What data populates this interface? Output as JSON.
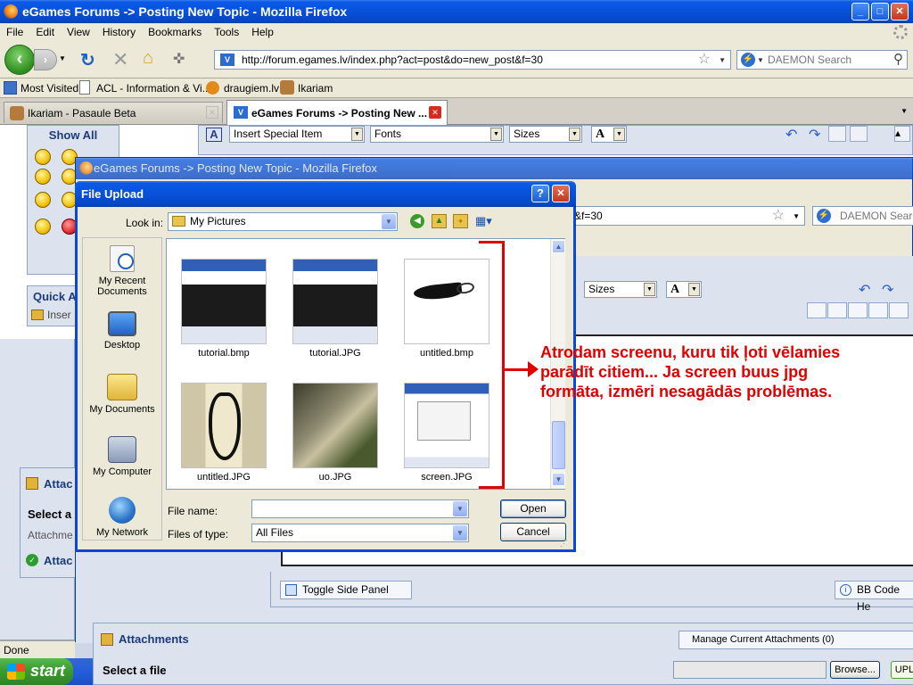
{
  "window": {
    "title": "eGames Forums -> Posting New Topic - Mozilla Firefox",
    "controls": {
      "min": "_",
      "max": "□",
      "close": "✕"
    }
  },
  "menu": [
    "File",
    "Edit",
    "View",
    "History",
    "Bookmarks",
    "Tools",
    "Help"
  ],
  "nav": {
    "url": "http://forum.egames.lv/index.php?act=post&do=new_post&f=30",
    "search_placeholder": "DAEMON Search"
  },
  "bookmarks": [
    "Most Visited",
    "ACL - Information & Vi...",
    "draugiem.lv",
    "Ikariam"
  ],
  "tabs": [
    {
      "label": "Ikariam - Pasaule Beta"
    },
    {
      "label": "eGames Forums -> Posting New ..."
    }
  ],
  "editor": {
    "insert_special": "Insert Special Item",
    "fonts": "Fonts",
    "sizes": "Sizes",
    "font_color": "A"
  },
  "sidebar": {
    "show_all": "Show All",
    "quick": "Quick A",
    "insert": "Inser",
    "attach": "Attac",
    "select_a": "Select a",
    "attachme": "Attachme",
    "attach2": "Attac"
  },
  "inner_window": {
    "title": "eGames Forums -> Posting New Topic - Mozilla Firefox",
    "url_tail": "&f=30",
    "search_placeholder": "DAEMON Search",
    "sizes": "Sizes",
    "font_color": "A"
  },
  "dialog": {
    "title": "File Upload",
    "help": "?",
    "close": "✕",
    "look_in_label": "Look in:",
    "look_in_value": "My Pictures",
    "places": [
      "My Recent Documents",
      "Desktop",
      "My Documents",
      "My Computer",
      "My Network"
    ],
    "files": [
      {
        "name": "tutorial.bmp"
      },
      {
        "name": "tutorial.JPG"
      },
      {
        "name": "untitled.bmp"
      },
      {
        "name": "untitled.JPG"
      },
      {
        "name": "uo.JPG"
      },
      {
        "name": "screen.JPG"
      }
    ],
    "file_name_label": "File name:",
    "file_name_value": "",
    "files_of_type_label": "Files of type:",
    "files_of_type_value": "All Files",
    "open": "Open",
    "cancel": "Cancel"
  },
  "annotation": "Atrodam screenu, kuru tik ļoti vēlamies parādīt citiem... Ja screen buus jpg formāta, izmēri nesagādās problēmas.",
  "bottom": {
    "toggle_side_panel": "Toggle Side Panel",
    "bbcode": "BB Code He",
    "attachments": "Attachments",
    "manage": "Manage Current Attachments (0)",
    "select_file": "Select a file",
    "browse": "Browse...",
    "upload": "UPL"
  },
  "status": {
    "text": "Done"
  },
  "taskbar": {
    "start": "start"
  },
  "colors": {
    "annotation": "#e00000",
    "xp_blue": "#0a5ae6"
  }
}
